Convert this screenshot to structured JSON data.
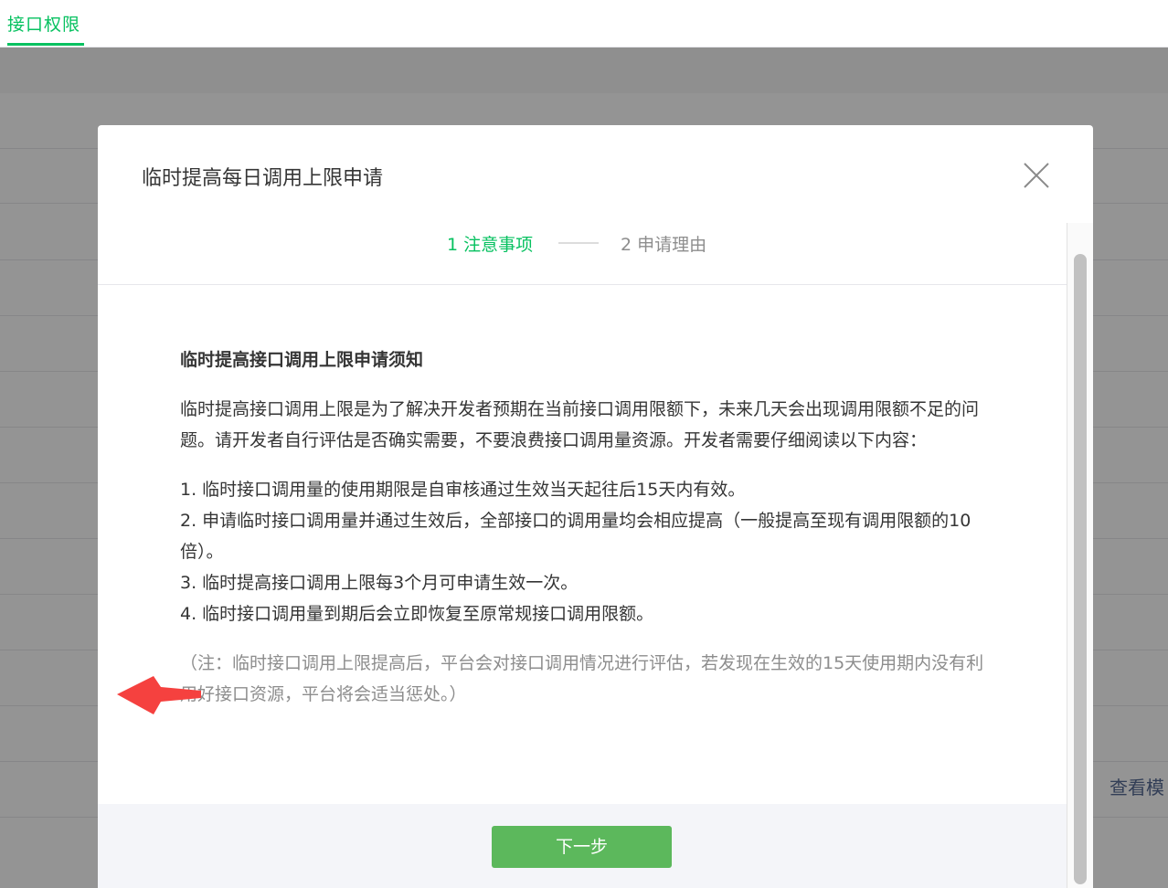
{
  "tab": {
    "label": "接口权限"
  },
  "background": {
    "link_label": "查看模"
  },
  "dialog": {
    "title": "临时提高每日调用上限申请",
    "steps": [
      {
        "label": "1 注意事项",
        "active": true
      },
      {
        "label": "2 申请理由",
        "active": false
      }
    ],
    "notice_title": "临时提高接口调用上限申请须知",
    "intro": "临时提高接口调用上限是为了解决开发者预期在当前接口调用限额下，未来几天会出现调用限额不足的问题。请开发者自行评估是否确实需要，不要浪费接口调用量资源。开发者需要仔细阅读以下内容：",
    "items": [
      "1. 临时接口调用量的使用期限是自审核通过生效当天起往后15天内有效。",
      "2. 申请临时接口调用量并通过生效后，全部接口的调用量均会相应提高（一般提高至现有调用限额的10倍）。",
      "3. 临时提高接口调用上限每3个月可申请生效一次。",
      "4. 临时接口调用量到期后会立即恢复至原常规接口调用限额。"
    ],
    "note": "（注：临时接口调用上限提高后，平台会对接口调用情况进行评估，若发现在生效的15天使用期内没有利用好接口资源，平台将会适当惩处。）",
    "next_button": "下一步"
  },
  "colors": {
    "brand_green": "#07c160",
    "button_green": "#5cb85c",
    "annotation_arrow": "#f5413f"
  }
}
